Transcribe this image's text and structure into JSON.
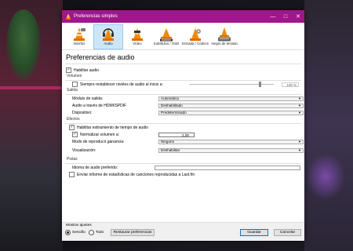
{
  "window": {
    "title": "Preferencias simples"
  },
  "toolbar": {
    "items": [
      {
        "label": "Interfaz"
      },
      {
        "label": "Audio"
      },
      {
        "label": "Vídeo"
      },
      {
        "label": "Subtítulos / OSD"
      },
      {
        "label": "Entrada / Códecs"
      },
      {
        "label": "Atajos de teclado"
      }
    ]
  },
  "page": {
    "title": "Preferencias de audio"
  },
  "general": {
    "enable_audio": "Habilitar audio",
    "enable_audio_checked": true
  },
  "volume": {
    "section": "Volumen",
    "reset_label": "Siempre restablecer niveles de audio al inicio a:",
    "reset_checked": false,
    "percent": "100 %",
    "level": 0.82
  },
  "output": {
    "section": "Salida",
    "module_label": "Módulo de salida:",
    "module_value": "Automática",
    "hdmi_label": "Audio a través de HDMI/SPDIF",
    "hdmi_value": "Deshabilitado",
    "device_label": "Dispositivo:",
    "device_value": "Predeterminado"
  },
  "effects": {
    "section": "Efectos",
    "stretch_label": "Habilitar estiramiento de tiempo de audio",
    "stretch_checked": true,
    "normalize_label": "Normalizar volumen a:",
    "normalize_checked": true,
    "normalize_value": "2,00",
    "replay_label": "Modo de reproducir ganancia:",
    "replay_value": "Ninguno",
    "vis_label": "Visualización:",
    "vis_value": "Deshabilitar"
  },
  "tracks": {
    "section": "Pistas",
    "lang_label": "Idioma de audio preferido:",
    "lang_value": "",
    "lastfm_label": "Enviar informe de estadísticas de canciones reproducidas a Last.fm",
    "lastfm_checked": false
  },
  "footer": {
    "show_settings": "Mostrar ajustes",
    "simple": "Sencillo",
    "all": "Todo",
    "reset": "Restaurar preferencias",
    "save": "Guardar",
    "cancel": "Cancelar"
  },
  "colors": {
    "titlebar": "#a0168c",
    "selected_tab": "#cde6f7",
    "accent": "#0078d7"
  },
  "icons": {
    "window": "vlc-cone-icon",
    "minimize": "minimize-icon",
    "maximize": "maximize-icon",
    "close": "close-icon"
  }
}
